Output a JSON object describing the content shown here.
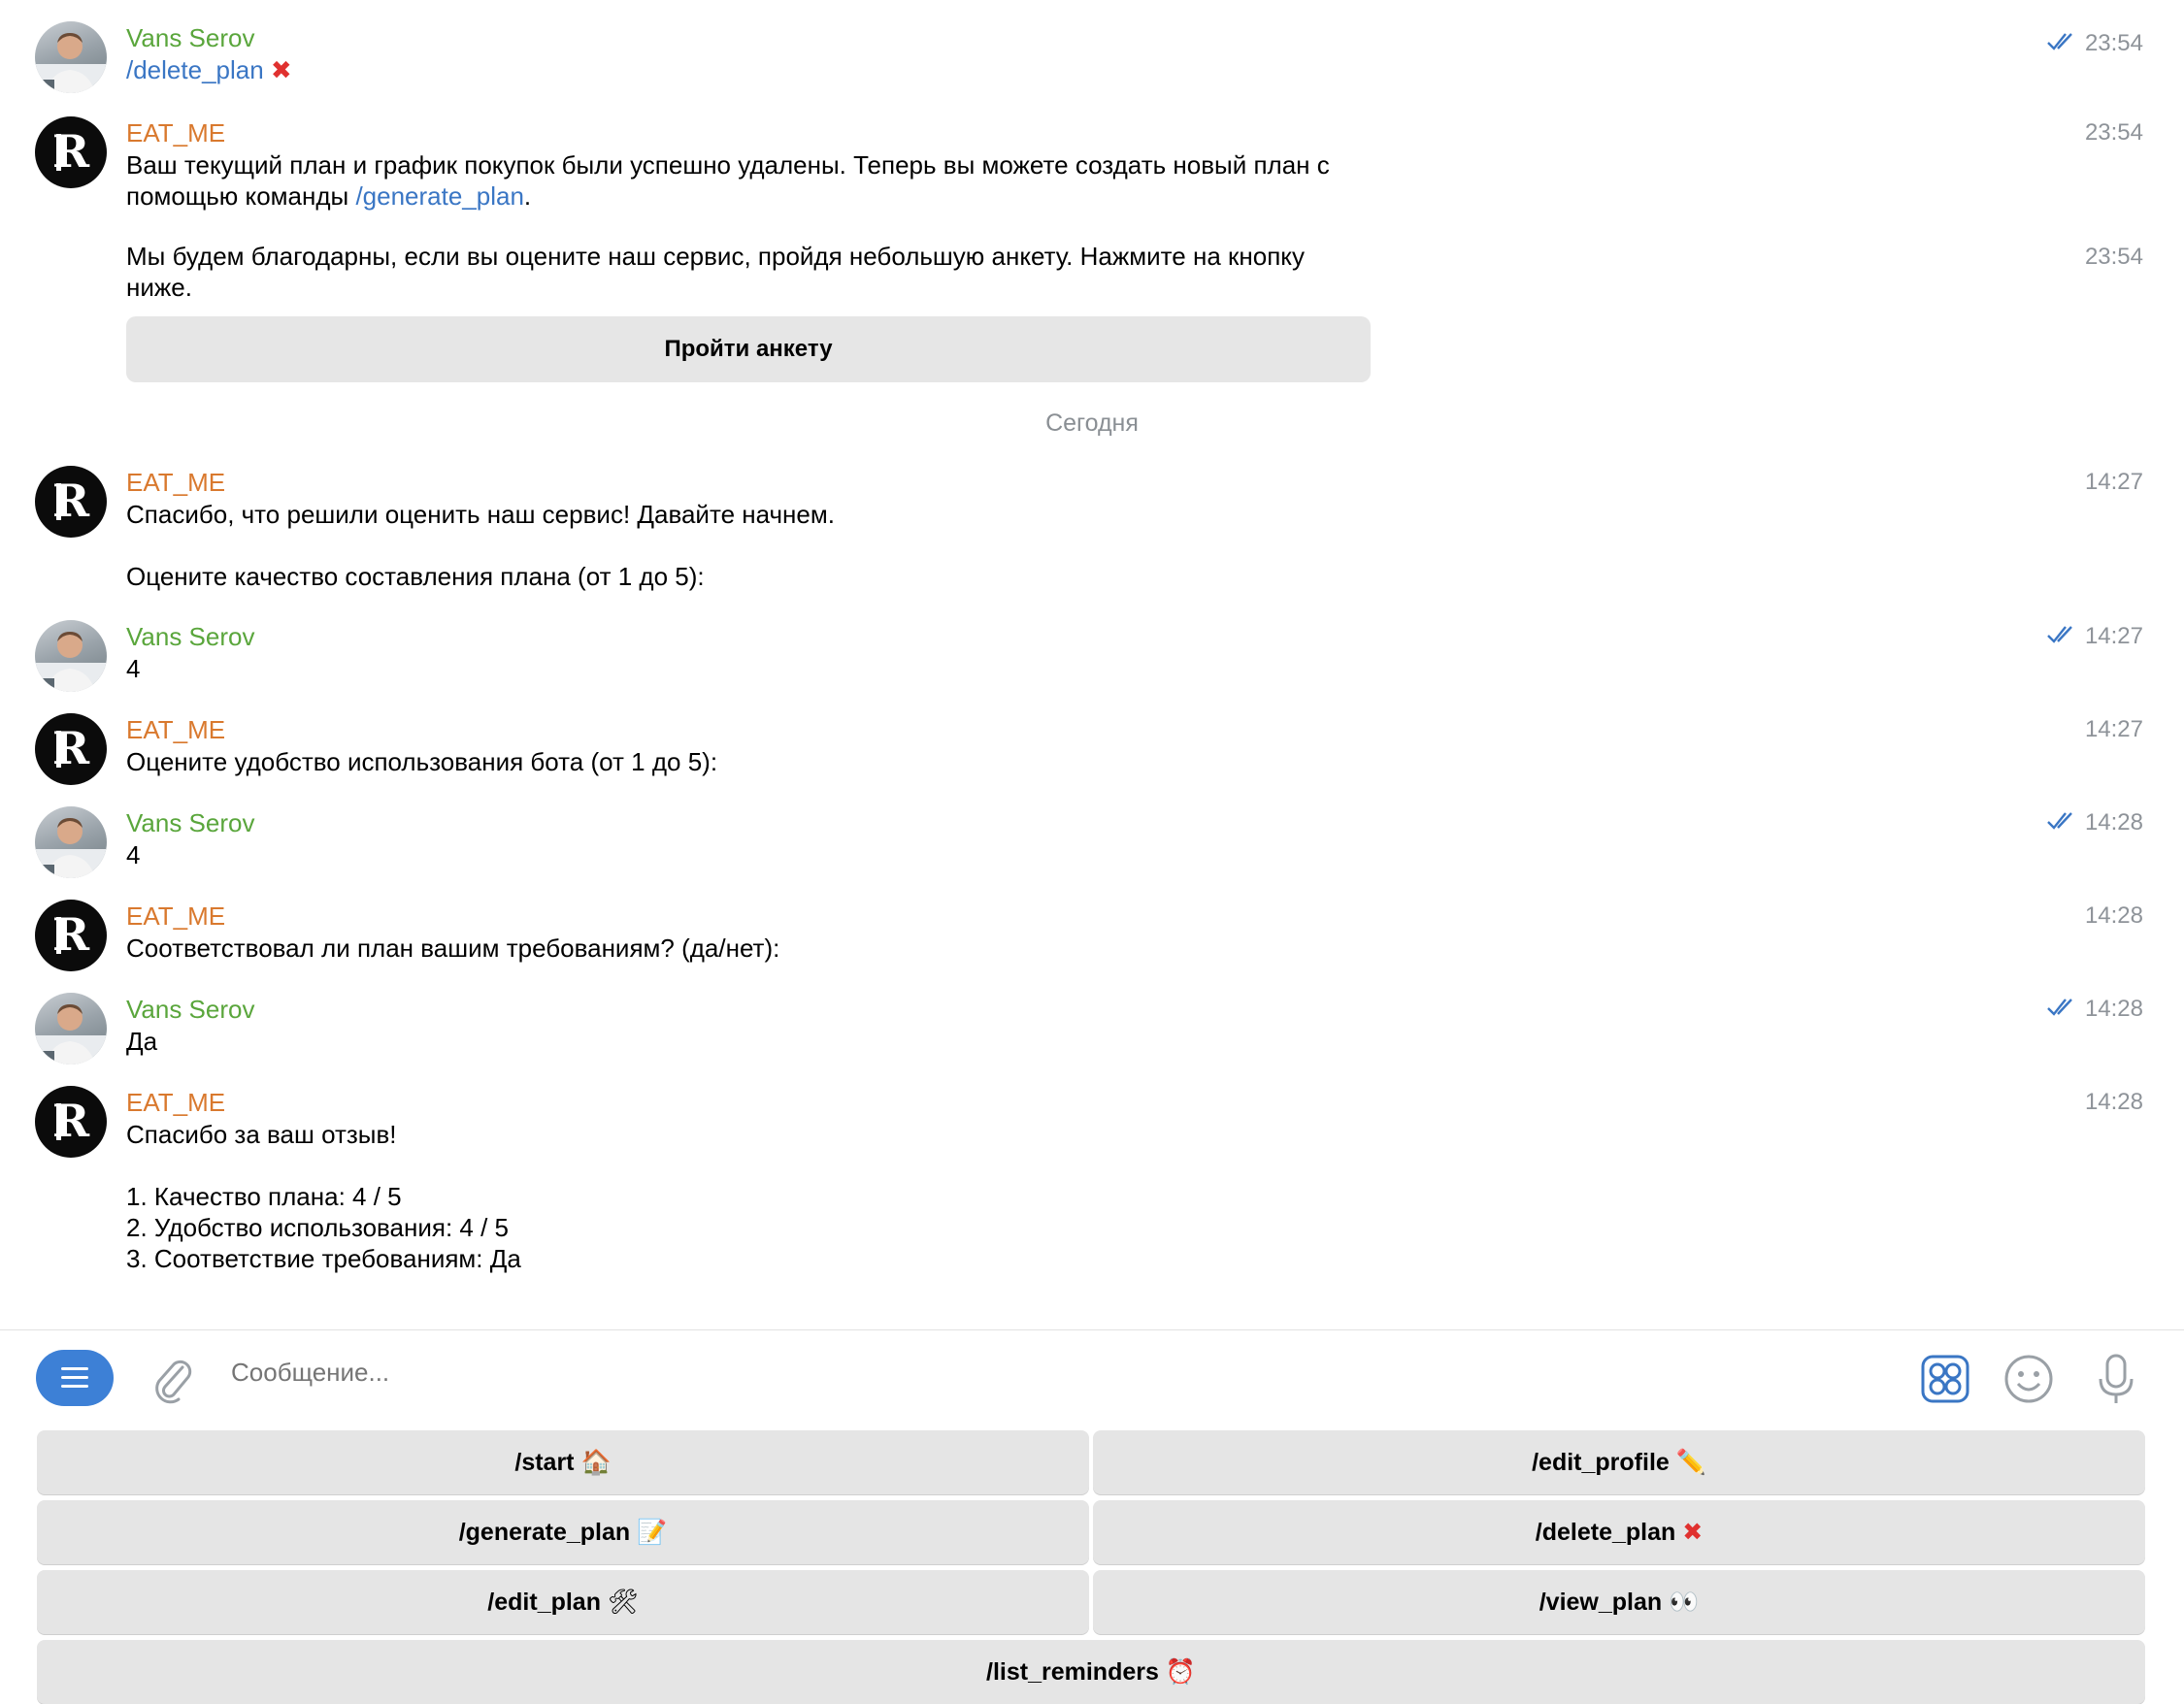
{
  "users": {
    "user_name": "Vans Serov",
    "bot_name": "EAT_ME"
  },
  "messages": {
    "m1": {
      "cmd": "/delete_plan",
      "emoji": "✖",
      "time": "23:54"
    },
    "m2": {
      "time": "23:54",
      "line1": "Ваш текущий план и график покупок были успешно удалены. Теперь вы можете создать новый план с",
      "line2_prefix": "помощью команды ",
      "line2_cmd": "/generate_plan",
      "line2_suffix": "."
    },
    "m3": {
      "time": "23:54",
      "line1": "Мы будем благодарны, если вы оцените наш сервис, пройдя небольшую анкету. Нажмите на кнопку",
      "line2": "ниже.",
      "button": "Пройти анкету"
    },
    "date_separator": "Сегодня",
    "m4": {
      "time": "14:27",
      "line1": "Спасибо, что решили оценить наш сервис! Давайте начнем.",
      "line2": "Оцените качество составления плана (от 1 до 5):"
    },
    "m5": {
      "time": "14:27",
      "text": "4"
    },
    "m6": {
      "time": "14:27",
      "text": "Оцените удобство использования бота (от 1 до 5):"
    },
    "m7": {
      "time": "14:28",
      "text": "4"
    },
    "m8": {
      "time": "14:28",
      "text": "Соответствовал ли план вашим требованиям? (да/нет):"
    },
    "m9": {
      "time": "14:28",
      "text": "Да"
    },
    "m10": {
      "time": "14:28",
      "line1": "Спасибо за ваш отзыв!",
      "item1": "1. Качество плана: 4 / 5",
      "item2": "2. Удобство использования: 4 / 5",
      "item3": "3. Соответствие требованиям: Да"
    }
  },
  "composer": {
    "placeholder": "Сообщение..."
  },
  "keyboard": {
    "start": {
      "label": "/start",
      "emoji": "🏠"
    },
    "edit_profile": {
      "label": "/edit_profile",
      "emoji": "✏️"
    },
    "generate_plan": {
      "label": "/generate_plan",
      "emoji": "📝"
    },
    "delete_plan": {
      "label": "/delete_plan",
      "emoji": "✖"
    },
    "edit_plan": {
      "label": "/edit_plan",
      "emoji": "🛠"
    },
    "view_plan": {
      "label": "/view_plan",
      "emoji": "👀"
    },
    "list_reminders": {
      "label": "/list_reminders",
      "emoji": "⏰"
    }
  },
  "colors": {
    "user_name": "#5aa63c",
    "bot_name": "#d9792e",
    "command_link": "#3a76c4",
    "menu_button": "#3d80d6"
  },
  "icons": {
    "menu": "menu-lines-icon",
    "attach": "paperclip-icon",
    "sticker": "sticker-grid-icon",
    "emoji": "smiley-icon",
    "mic": "microphone-icon",
    "read": "double-check-icon",
    "bot_avatar": "hse-logo-avatar",
    "user_avatar": "user-photo-avatar"
  }
}
